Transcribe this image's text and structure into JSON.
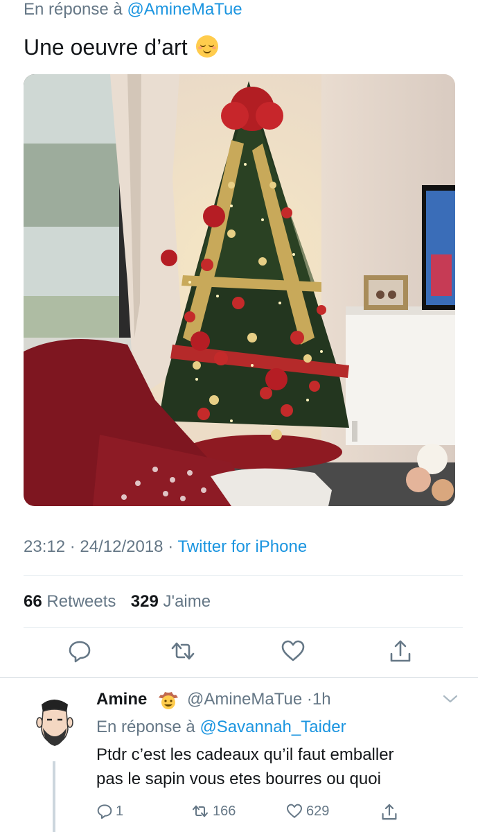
{
  "tweet": {
    "reply_prefix": "En réponse à ",
    "reply_handle": "@AmineMaTue",
    "text": "Une oeuvre d’art",
    "emoji_icon": "relieved-face-icon",
    "time": "23:12",
    "date": "24/12/2018",
    "source": "Twitter for iPhone",
    "retweets_count": "66",
    "retweets_label": "Retweets",
    "likes_count": "329",
    "likes_label": "J'aime"
  },
  "reply": {
    "name": "Amine",
    "badge_icon": "cowboy-face-icon",
    "handle": "@AmineMaTue",
    "time": "1h",
    "reply_prefix": "En réponse à ",
    "reply_handle": "@Savannah_Taider",
    "text_line1": "Ptdr c’est les cadeaux qu’il faut emballer",
    "text_line2": "pas le sapin vous etes bourres ou quoi",
    "reply_count": "1",
    "retweet_count": "166",
    "like_count": "629"
  },
  "colors": {
    "link": "#1b95e0",
    "secondary_text": "#657786",
    "primary_text": "#14171a",
    "divider": "#e1e8ed"
  }
}
